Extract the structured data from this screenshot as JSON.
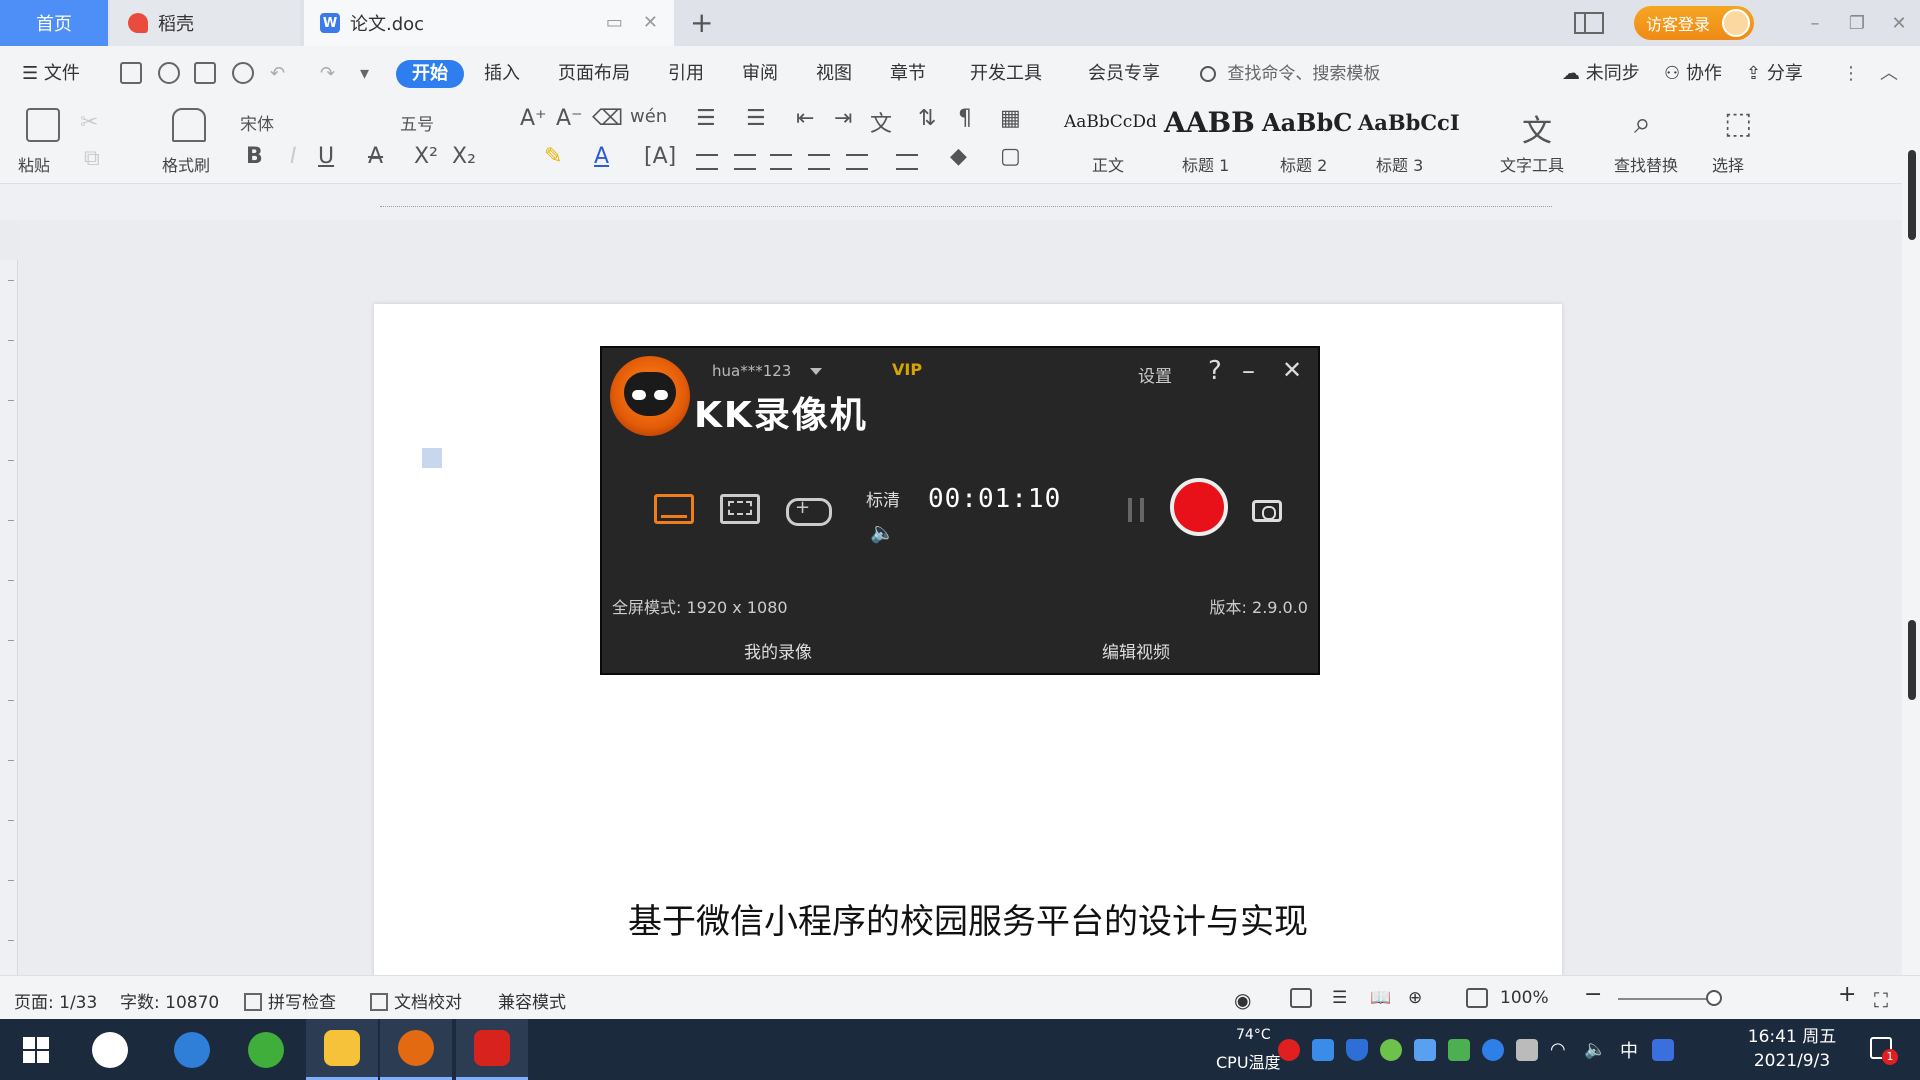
{
  "tabs": {
    "home": "首页",
    "daoke": "稻壳",
    "doc": "论文.doc"
  },
  "window": {
    "login_label": "访客登录"
  },
  "menu": {
    "file": "文件",
    "start": "开始",
    "insert": "插入",
    "layout": "页面布局",
    "reference": "引用",
    "review": "审阅",
    "view": "视图",
    "chapter": "章节",
    "devtools": "开发工具",
    "vip": "会员专享",
    "search_cmd": "查找命令、搜索模板",
    "sync": "未同步",
    "collab": "协作",
    "share": "分享"
  },
  "ribbon": {
    "paste": "粘贴",
    "format_painter": "格式刷",
    "font_name": "宋体",
    "font_size": "五号",
    "style_normal_preview": "AaBbCcDd",
    "style_normal": "正文",
    "style_h1_preview": "AABB",
    "style_h1": "标题 1",
    "style_h2_preview": "AaBbC",
    "style_h2": "标题 2",
    "style_h3_preview": "AaBbCcI",
    "style_h3": "标题 3",
    "text_tools": "文字工具",
    "find_replace": "查找替换",
    "select": "选择"
  },
  "kk": {
    "username": "hua***123",
    "vip": "VIP",
    "title": "KK录像机",
    "settings": "设置",
    "help": "?",
    "minimize": "–",
    "close": "✕",
    "quality": "标清",
    "timer": "00:01:10",
    "fullscreen_mode": "全屏模式: 1920 x 1080",
    "version": "版本: 2.9.0.0",
    "my_recordings": "我的录像",
    "edit_video": "编辑视频",
    "accent_color": "#f07d18",
    "record_color": "#e8111a"
  },
  "document": {
    "title": "基于微信小程序的校园服务平台的设计与实现"
  },
  "status": {
    "page": "页面: 1/33",
    "words": "字数: 10870",
    "spellcheck": "拼写检查",
    "proofread": "文档校对",
    "compat": "兼容模式",
    "zoom": "100%",
    "zoom_minus": "−",
    "zoom_plus": "+"
  },
  "taskbar": {
    "cpu_temp": "74°C",
    "cpu_label": "CPU温度",
    "ime": "中",
    "time": "16:41 周五",
    "date": "2021/9/3",
    "notification_count": "1"
  }
}
